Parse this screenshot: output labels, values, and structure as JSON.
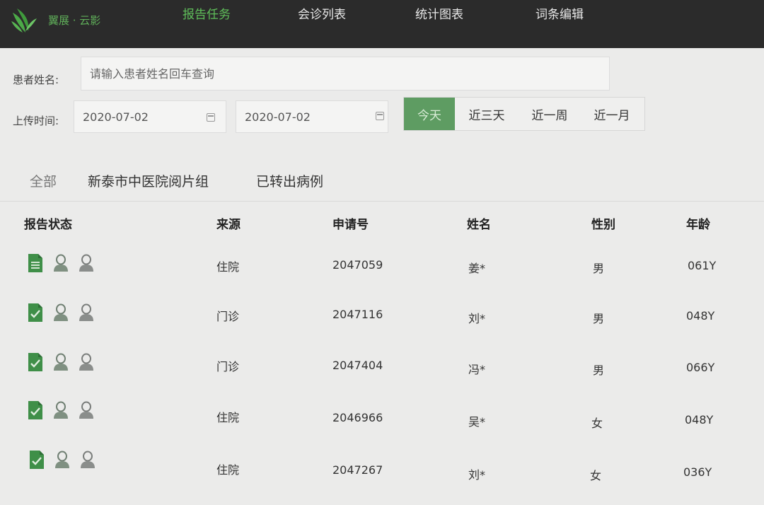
{
  "app": {
    "brand": "翼展 · 云影"
  },
  "nav": [
    {
      "label": "报告任务",
      "active": true
    },
    {
      "label": "会诊列表",
      "active": false
    },
    {
      "label": "统计图表",
      "active": false
    },
    {
      "label": "词条编辑",
      "active": false
    }
  ],
  "filters": {
    "patient_label": "患者姓名:",
    "patient_placeholder": "请输入患者姓名回车查询",
    "upload_label": "上传时间:",
    "date_from": "2020-07-02",
    "date_to": "2020-07-02",
    "ranges": [
      {
        "label": "今天",
        "active": true
      },
      {
        "label": "近三天",
        "active": false
      },
      {
        "label": "近一周",
        "active": false
      },
      {
        "label": "近一月",
        "active": false
      }
    ]
  },
  "tabs": [
    "全部",
    "新泰市中医院阅片组",
    "已转出病例"
  ],
  "table": {
    "headers": [
      "报告状态",
      "来源",
      "申请号",
      "姓名",
      "性别",
      "年龄"
    ],
    "rows": [
      {
        "status": "document-list-icon",
        "source": "住院",
        "apply_no": "2047059",
        "name": "姜*",
        "gender": "男",
        "age": "061Y"
      },
      {
        "status": "document-check-icon",
        "source": "门诊",
        "apply_no": "2047116",
        "name": "刘*",
        "gender": "男",
        "age": "048Y"
      },
      {
        "status": "document-check-icon",
        "source": "门诊",
        "apply_no": "2047404",
        "name": "冯*",
        "gender": "男",
        "age": "066Y"
      },
      {
        "status": "document-check-icon",
        "source": "住院",
        "apply_no": "2046966",
        "name": "吴*",
        "gender": "女",
        "age": "048Y"
      },
      {
        "status": "document-check-icon",
        "source": "住院",
        "apply_no": "2047267",
        "name": "刘*",
        "gender": "女",
        "age": "036Y"
      }
    ]
  },
  "colors": {
    "accent": "#5fbf5a",
    "topbar": "#2b2b2b",
    "active_range": "#5e9c62"
  }
}
